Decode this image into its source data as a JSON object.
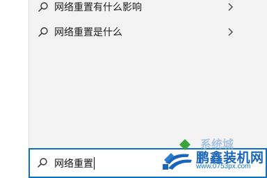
{
  "suggestions": [
    {
      "text": "网络重置有什么影响"
    },
    {
      "text": "网络重置是什么"
    }
  ],
  "search": {
    "query": "网络重置"
  },
  "watermark": {
    "top_text": "系统城",
    "title": "鹏鑫装机网",
    "url": "www.0753px.com"
  },
  "colors": {
    "accent": "#0b6fc4",
    "panel_bg": "#f3f3f3"
  }
}
